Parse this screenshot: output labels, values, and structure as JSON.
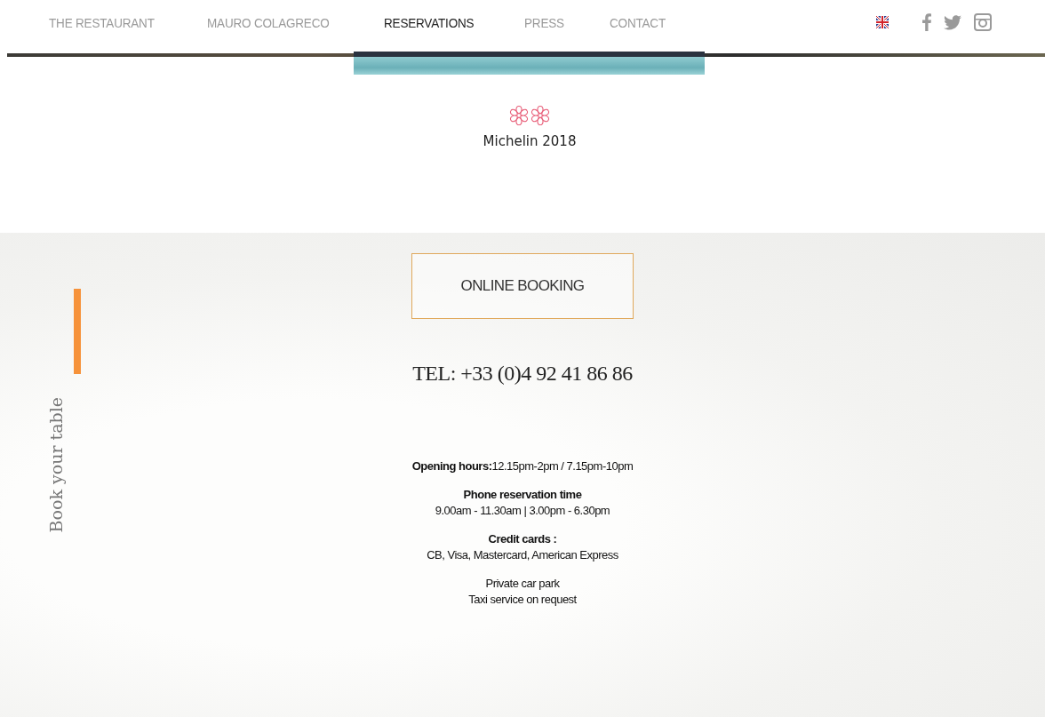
{
  "nav": {
    "items": [
      {
        "label": "THE RESTAURANT",
        "selected": false
      },
      {
        "label": "MAURO COLAGRECO",
        "selected": false
      },
      {
        "label": "RESERVATIONS",
        "selected": true
      },
      {
        "label": "PRESS",
        "selected": false
      },
      {
        "label": "CONTACT",
        "selected": false
      }
    ]
  },
  "award": {
    "marks": [
      {
        "kind": "flower"
      },
      {
        "kind": "flower"
      }
    ],
    "caption": "Michelin 2018"
  },
  "booking": {
    "side_title": "Book your table",
    "button": "ONLINE BOOKING",
    "phone": "TEL: +33 (0)4 92 41 86 86",
    "info": [
      {
        "lines": [
          "**Opening hours:**12.15pm-2pm / 7.15pm-10pm"
        ]
      },
      {
        "title": "Phone reservation time",
        "lines": [
          "9.00am - 11.30am | 3.00pm - 6.30pm"
        ]
      },
      {
        "title": "Credit cards :",
        "lines": [
          "CB, Visa, Mastercard, American Express"
        ]
      },
      {
        "lines": [
          "Private car park",
          "Taxi service on request"
        ]
      }
    ]
  }
}
